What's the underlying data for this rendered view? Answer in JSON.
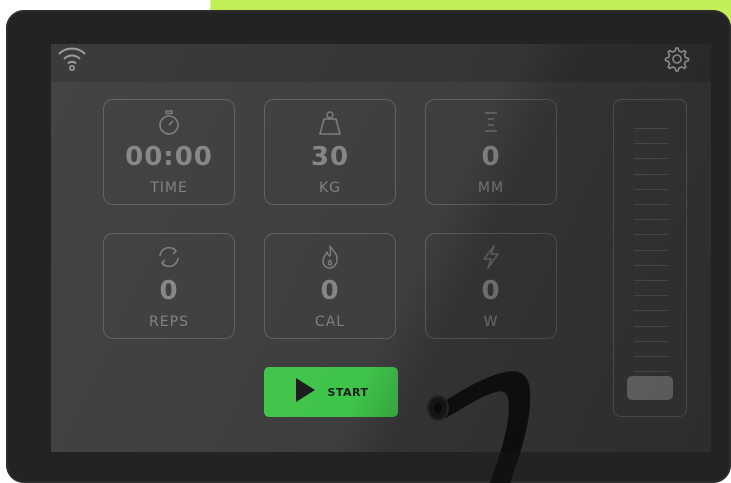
{
  "tiles": [
    {
      "icon": "stopwatch-icon",
      "value": "00:00",
      "unit": "TIME"
    },
    {
      "icon": "weight-icon",
      "value": "30",
      "unit": "KG"
    },
    {
      "icon": "distance-icon",
      "value": "0",
      "unit": "MM"
    },
    {
      "icon": "repeat-icon",
      "value": "0",
      "unit": "REPS"
    },
    {
      "icon": "flame-icon",
      "value": "0",
      "unit": "CAL"
    },
    {
      "icon": "bolt-icon",
      "value": "0",
      "unit": "W"
    }
  ],
  "start_button": {
    "label": "START",
    "icon": "play-icon"
  },
  "status": {
    "wifi_icon": "wifi-icon",
    "settings_icon": "gear-icon"
  },
  "slider": {
    "level_fraction": 0.0,
    "tick_count": 17
  },
  "colors": {
    "accent": "#3fc44a",
    "background_brand": "#c2ee56"
  }
}
